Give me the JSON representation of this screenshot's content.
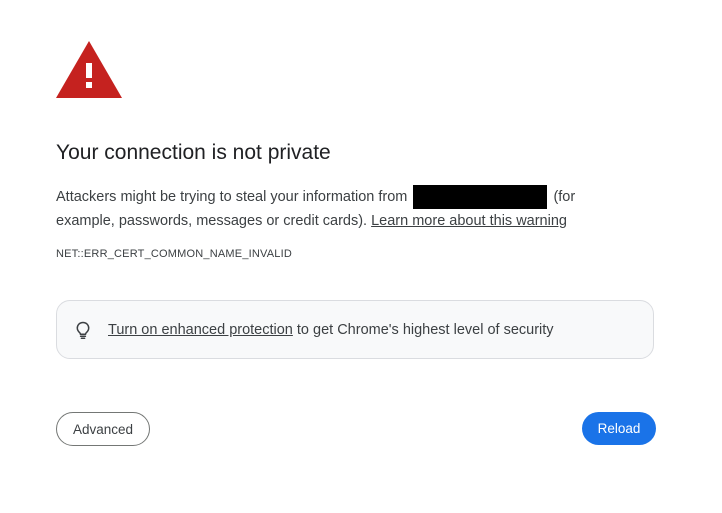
{
  "header": {
    "icon": "warning-triangle-icon",
    "title": "Your connection is not private"
  },
  "message": {
    "text_before": "Attackers might be trying to steal your information from",
    "text_after": "(for example, passwords, messages or credit cards).",
    "learn_more_link": "Learn more about this warning"
  },
  "error_code": "NET::ERR_CERT_COMMON_NAME_INVALID",
  "promo": {
    "icon": "lightbulb-icon",
    "link_text": "Turn on enhanced protection",
    "text": "to get Chrome's highest level of security"
  },
  "buttons": {
    "advanced_label": "Advanced",
    "reload_label": "Reload"
  },
  "colors": {
    "warning": "#c5221f",
    "primary": "#1a73e8",
    "text": "#202124",
    "secondary_text": "#3c4043"
  }
}
